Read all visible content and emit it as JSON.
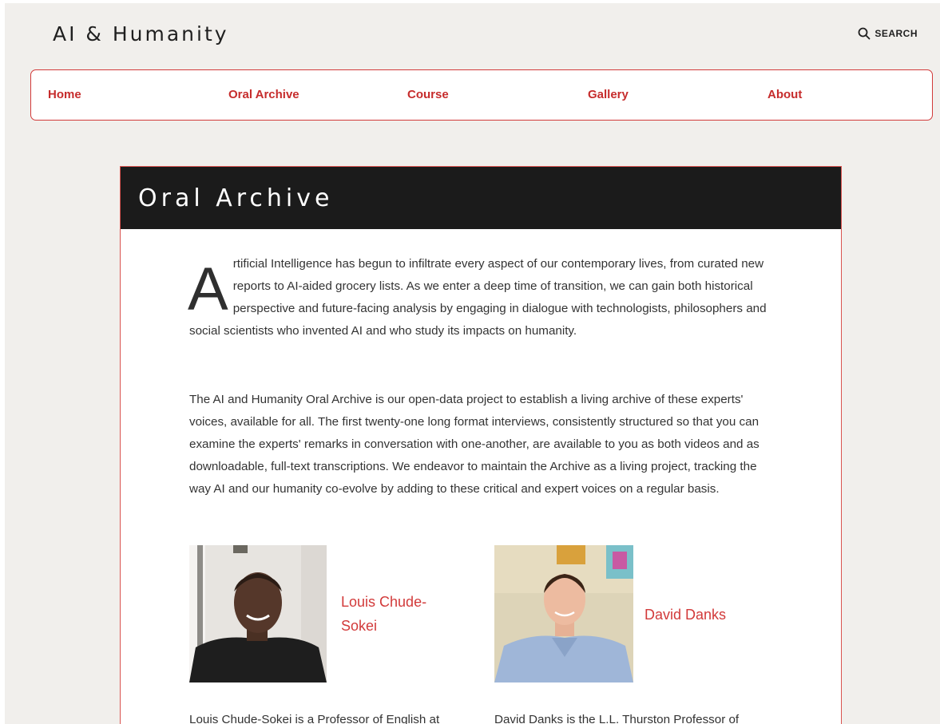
{
  "site": {
    "title": "AI & Humanity",
    "search_label": "SEARCH"
  },
  "nav": {
    "items": [
      {
        "label": "Home"
      },
      {
        "label": "Oral Archive"
      },
      {
        "label": "Course"
      },
      {
        "label": "Gallery"
      },
      {
        "label": "About"
      }
    ]
  },
  "page": {
    "title": "Oral Archive",
    "intro_dropcap": "A",
    "intro_rest": "rtificial Intelligence has begun to infiltrate every aspect of our contemporary lives, from curated new reports to AI-aided grocery lists. As we enter a deep time of transition, we can gain both historical perspective and future-facing analysis by engaging in dialogue with technologists, philosophers and social scientists who invented AI and who study its impacts on humanity.",
    "paragraph2": "The AI and Humanity Oral Archive is our open-data project to establish a living archive of these experts' voices, available for all. The first twenty-one long format interviews, consistently structured so that you can examine the experts' remarks in conversation with one-another, are available to you as both videos and as downloadable, full-text transcriptions. We endeavor to maintain the Archive as a living project, tracking the way AI and our humanity co-evolve by adding to these critical and expert voices on a regular basis."
  },
  "people": [
    {
      "name": "Louis Chude-Sokei",
      "bio": "Louis Chude-Sokei is a Professor of English at"
    },
    {
      "name": "David Danks",
      "bio": "David Danks is the L.L. Thurston Professor of"
    }
  ],
  "colors": {
    "accent": "#d23a3a",
    "header_bg": "#1b1b1b",
    "page_bg": "#f1efec"
  }
}
